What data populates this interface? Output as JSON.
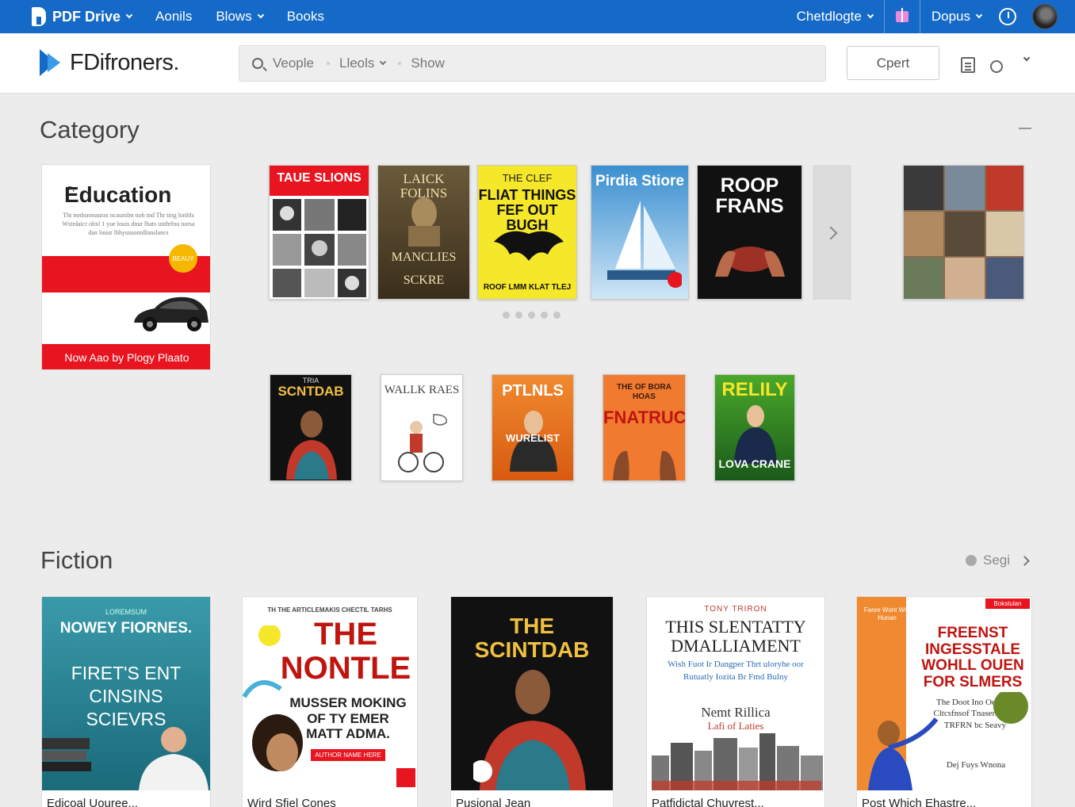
{
  "topbar": {
    "brand": "PDF Drive",
    "nav": [
      {
        "label": "Aonils",
        "dropdown": false
      },
      {
        "label": "Blows",
        "dropdown": true
      },
      {
        "label": "Books",
        "dropdown": false
      }
    ],
    "right": [
      {
        "label": "Chetdlogte",
        "dropdown": true
      },
      {
        "label": "Dopus",
        "dropdown": true
      }
    ]
  },
  "header": {
    "logo": "FDifroners.",
    "search": {
      "item1": "Veople",
      "item2": "Lleols",
      "item3": "Show"
    },
    "open_label": "Cpert"
  },
  "category": {
    "title": "Category",
    "featured": {
      "title": "Education",
      "tiny": "Pr",
      "body": "Tht mnhsmnauras ncaumlm noh tnd Thr ting lonltls Wstrdaicr ohxl 1 yue louis dnur lhats unthrlnu norsa dan lnuur lhhysnsonrdlnnslancs",
      "badge": "BEAUY",
      "footer": "Now Aao by Plogy Plaato"
    },
    "row1": [
      {
        "title": "TAUE SLIONS",
        "sub": ""
      },
      {
        "title": "LAICK FOLINS",
        "sub": "MANCLIES SCKRE"
      },
      {
        "title": "FLIAT THINGS FEF OUT BUGH",
        "top": "THE CLEF",
        "sub": "ROOF LMM KLAT TLEJ"
      },
      {
        "title": "Pirdia Stiore",
        "sub": ""
      },
      {
        "title": "ROOP FRANS",
        "sub": ""
      }
    ],
    "row2": [
      {
        "title": "SCNTDAB",
        "top": "TRIA"
      },
      {
        "title": "WALLK RAES"
      },
      {
        "title": "PTLNLS",
        "sub": "WURELIST"
      },
      {
        "title": "FNATRUCT",
        "top": "THE OF BORA HOAS"
      },
      {
        "title": "RELILY",
        "sub": "LOVA CRANE"
      }
    ]
  },
  "fiction": {
    "title": "Fiction",
    "see_all": "Segi",
    "books": [
      {
        "small": "LOREMSUM",
        "title": "NOWEY FIORNES.",
        "sub": "FIRET'S ENT CINSINS SCIEVRS",
        "caption": "Edicoal Uouree..."
      },
      {
        "top": "TH THE ARTICLEMAKIS CHECTIL TARHS",
        "title": "THE NONTLE",
        "sub": "MUSSER MOKING OF TY EMER MATT ADMA.",
        "badge": "AUTHOR NAME HERE",
        "caption": "Wird Sfiel Cones"
      },
      {
        "title": "THE SCINTDAB",
        "caption": "Pusional Jean"
      },
      {
        "top": "TONY TRIRON",
        "title": "THIS SLENTATTY DMALLIAMENT",
        "sub": "Wish Fuot Ir Dangper Thrt uloryhe oor Rutuatly Iozita Br Fmd Bulny",
        "author": "Nemt Rillica",
        "author2": "Lafi of Laties",
        "caption": "Patfidictal Chuvrest..."
      },
      {
        "top": "Fanre Wont Wro Hunan",
        "flag": "Bokstulan",
        "title": "FREENST INGESSTALE WOHLL OUEN FOR SLMERS",
        "sub": "The Doot Ino Oeiesud Cltcsfnsof Tnaserbrarac TRFRN bc Seavy",
        "author": "Dej Fuys Wnona",
        "caption": "Post Which Ehastre..."
      }
    ]
  },
  "colors": {
    "brand": "#1569c7",
    "red": "#e8141f",
    "yellow": "#f5e72a"
  }
}
